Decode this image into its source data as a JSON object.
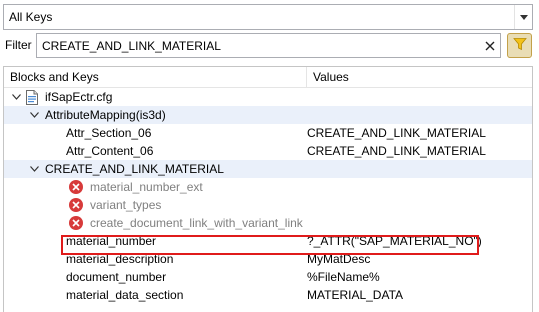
{
  "key_filter": {
    "selected": "All Keys"
  },
  "filter": {
    "label": "Filter",
    "value": "CREATE_AND_LINK_MATERIAL"
  },
  "tree": {
    "columns": {
      "keys": "Blocks and Keys",
      "values": "Values"
    },
    "file": "ifSapEctr.cfg",
    "groups": [
      {
        "name": "AttributeMapping(is3d)",
        "entries": [
          {
            "key": "Attr_Section_06",
            "value": "CREATE_AND_LINK_MATERIAL"
          },
          {
            "key": "Attr_Content_06",
            "value": "CREATE_AND_LINK_MATERIAL"
          }
        ]
      },
      {
        "name": "CREATE_AND_LINK_MATERIAL",
        "errors": [
          {
            "key": "material_number_ext"
          },
          {
            "key": "variant_types"
          },
          {
            "key": "create_document_link_with_variant_link"
          }
        ],
        "entries": [
          {
            "key": "material_number",
            "value": "?_ATTR(\"SAP_MATERIAL_NO\")"
          },
          {
            "key": "material_description",
            "value": "MyMatDesc"
          },
          {
            "key": "document_number",
            "value": "%FileName%"
          },
          {
            "key": "material_data_section",
            "value": "MATERIAL_DATA"
          }
        ]
      }
    ]
  }
}
